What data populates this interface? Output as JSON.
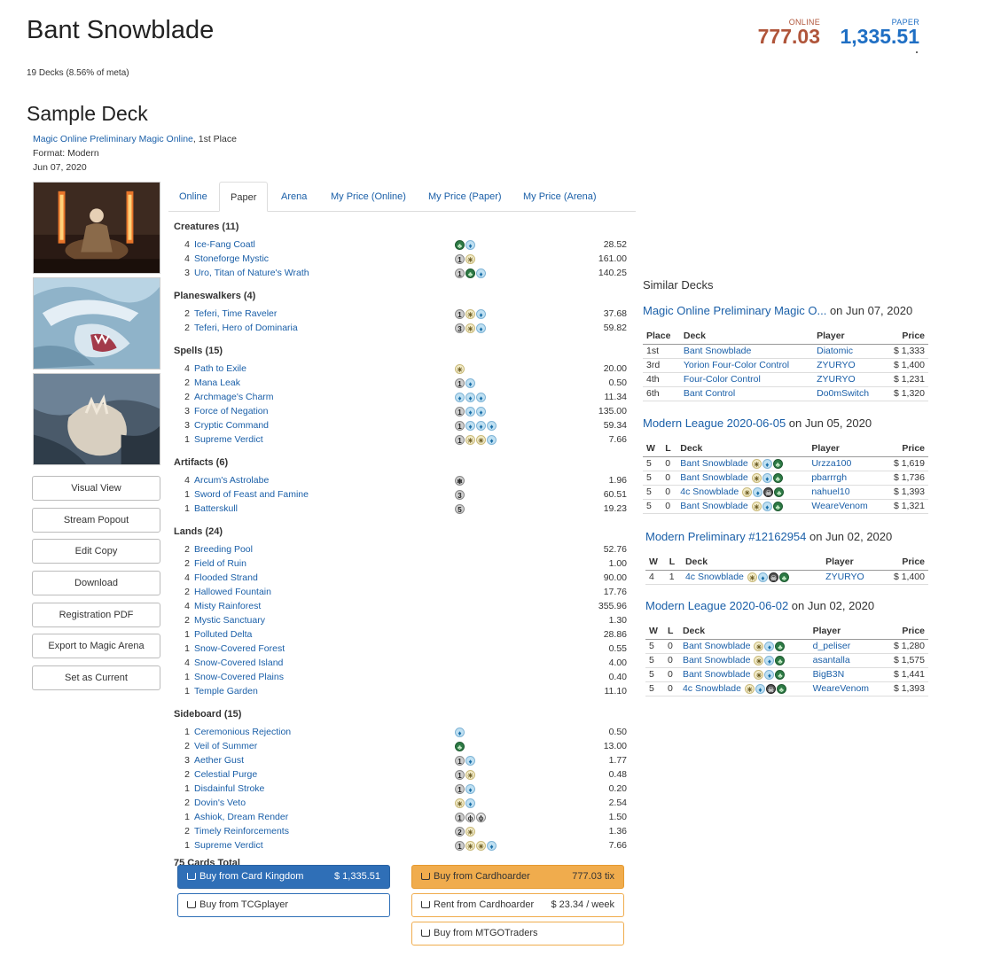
{
  "archetype": {
    "title": "Bant Snowblade",
    "meta_count": "19 Decks (8.56% of meta)"
  },
  "prices": {
    "online_label": "ONLINE",
    "online_value": "777.03",
    "paper_label": "PAPER",
    "paper_value": "1,335.51"
  },
  "sample": {
    "heading": "Sample Deck",
    "event_link": "Magic Online Preliminary Magic Online",
    "place": ", 1st Place",
    "format": "Format: Modern",
    "date": "Jun 07, 2020"
  },
  "side_buttons": [
    "Visual View",
    "Stream Popout",
    "Edit Copy",
    "Download",
    "Registration PDF",
    "Export to Magic Arena",
    "Set as Current"
  ],
  "tabs": [
    "Online",
    "Paper",
    "Arena",
    "My Price (Online)",
    "My Price (Paper)",
    "My Price (Arena)"
  ],
  "active_tab": "Paper",
  "deck": {
    "sections": [
      {
        "title": "Creatures (11)",
        "cards": [
          {
            "qty": "4",
            "name": "Ice-Fang Coatl",
            "mana": [
              "G",
              "U"
            ],
            "price": "28.52"
          },
          {
            "qty": "4",
            "name": "Stoneforge Mystic",
            "mana": [
              "1",
              "W"
            ],
            "price": "161.00"
          },
          {
            "qty": "3",
            "name": "Uro, Titan of Nature's Wrath",
            "mana": [
              "1",
              "G",
              "U"
            ],
            "price": "140.25"
          }
        ]
      },
      {
        "title": "Planeswalkers (4)",
        "cards": [
          {
            "qty": "2",
            "name": "Teferi, Time Raveler",
            "mana": [
              "1",
              "W",
              "U"
            ],
            "price": "37.68"
          },
          {
            "qty": "2",
            "name": "Teferi, Hero of Dominaria",
            "mana": [
              "3",
              "W",
              "U"
            ],
            "price": "59.82"
          }
        ]
      },
      {
        "title": "Spells (15)",
        "cards": [
          {
            "qty": "4",
            "name": "Path to Exile",
            "mana": [
              "W"
            ],
            "price": "20.00"
          },
          {
            "qty": "2",
            "name": "Mana Leak",
            "mana": [
              "1",
              "U"
            ],
            "price": "0.50"
          },
          {
            "qty": "2",
            "name": "Archmage's Charm",
            "mana": [
              "U",
              "U",
              "U"
            ],
            "price": "11.34"
          },
          {
            "qty": "3",
            "name": "Force of Negation",
            "mana": [
              "1",
              "U",
              "U"
            ],
            "price": "135.00"
          },
          {
            "qty": "3",
            "name": "Cryptic Command",
            "mana": [
              "1",
              "U",
              "U",
              "U"
            ],
            "price": "59.34"
          },
          {
            "qty": "1",
            "name": "Supreme Verdict",
            "mana": [
              "1",
              "W",
              "W",
              "U"
            ],
            "price": "7.66"
          }
        ]
      },
      {
        "title": "Artifacts (6)",
        "cards": [
          {
            "qty": "4",
            "name": "Arcum's Astrolabe",
            "mana": [
              "S"
            ],
            "price": "1.96"
          },
          {
            "qty": "1",
            "name": "Sword of Feast and Famine",
            "mana": [
              "3"
            ],
            "price": "60.51"
          },
          {
            "qty": "1",
            "name": "Batterskull",
            "mana": [
              "5"
            ],
            "price": "19.23"
          }
        ]
      },
      {
        "title": "Lands (24)",
        "cards": [
          {
            "qty": "2",
            "name": "Breeding Pool",
            "mana": [],
            "price": "52.76"
          },
          {
            "qty": "2",
            "name": "Field of Ruin",
            "mana": [],
            "price": "1.00"
          },
          {
            "qty": "4",
            "name": "Flooded Strand",
            "mana": [],
            "price": "90.00"
          },
          {
            "qty": "2",
            "name": "Hallowed Fountain",
            "mana": [],
            "price": "17.76"
          },
          {
            "qty": "4",
            "name": "Misty Rainforest",
            "mana": [],
            "price": "355.96"
          },
          {
            "qty": "2",
            "name": "Mystic Sanctuary",
            "mana": [],
            "price": "1.30"
          },
          {
            "qty": "1",
            "name": "Polluted Delta",
            "mana": [],
            "price": "28.86"
          },
          {
            "qty": "1",
            "name": "Snow-Covered Forest",
            "mana": [],
            "price": "0.55"
          },
          {
            "qty": "4",
            "name": "Snow-Covered Island",
            "mana": [],
            "price": "4.00"
          },
          {
            "qty": "1",
            "name": "Snow-Covered Plains",
            "mana": [],
            "price": "0.40"
          },
          {
            "qty": "1",
            "name": "Temple Garden",
            "mana": [],
            "price": "11.10"
          }
        ]
      },
      {
        "title": "Sideboard (15)",
        "cards": [
          {
            "qty": "1",
            "name": "Ceremonious Rejection",
            "mana": [
              "U"
            ],
            "price": "0.50"
          },
          {
            "qty": "2",
            "name": "Veil of Summer",
            "mana": [
              "G"
            ],
            "price": "13.00"
          },
          {
            "qty": "3",
            "name": "Aether Gust",
            "mana": [
              "1",
              "U"
            ],
            "price": "1.77"
          },
          {
            "qty": "2",
            "name": "Celestial Purge",
            "mana": [
              "1",
              "W"
            ],
            "price": "0.48"
          },
          {
            "qty": "1",
            "name": "Disdainful Stroke",
            "mana": [
              "1",
              "U"
            ],
            "price": "0.20"
          },
          {
            "qty": "2",
            "name": "Dovin's Veto",
            "mana": [
              "W",
              "U"
            ],
            "price": "2.54"
          },
          {
            "qty": "1",
            "name": "Ashiok, Dream Render",
            "mana": [
              "1",
              "P",
              "P"
            ],
            "price": "1.50"
          },
          {
            "qty": "2",
            "name": "Timely Reinforcements",
            "mana": [
              "2",
              "W"
            ],
            "price": "1.36"
          },
          {
            "qty": "1",
            "name": "Supreme Verdict",
            "mana": [
              "1",
              "W",
              "W",
              "U"
            ],
            "price": "7.66"
          }
        ]
      }
    ],
    "total": "75 Cards Total"
  },
  "buy": {
    "ck_label": "Buy from Card Kingdom",
    "ck_price": "$ 1,335.51",
    "tcg_label": "Buy from TCGplayer",
    "ch_label": "Buy from Cardhoarder",
    "ch_price": "777.03 tix",
    "rent_label": "Rent from Cardhoarder",
    "rent_price": "$ 23.34 / week",
    "mtgo_label": "Buy from MTGOTraders"
  },
  "similar": {
    "title": "Similar Decks",
    "events": [
      {
        "name": "Magic Online Preliminary Magic O...",
        "date": " on Jun 07, 2020",
        "headers": [
          "Place",
          "Deck",
          "Player",
          "Price"
        ],
        "rows": [
          {
            "a": "1st",
            "deck": "Bant Snowblade",
            "colors": [],
            "player": "Diatomic",
            "price": "$ 1,333"
          },
          {
            "a": "3rd",
            "deck": "Yorion Four-Color Control",
            "colors": [],
            "player": "ZYURYO",
            "price": "$ 1,400"
          },
          {
            "a": "4th",
            "deck": "Four-Color Control",
            "colors": [],
            "player": "ZYURYO",
            "price": "$ 1,231"
          },
          {
            "a": "6th",
            "deck": "Bant Control",
            "colors": [],
            "player": "Do0mSwitch",
            "price": "$ 1,320"
          }
        ]
      },
      {
        "name": "Modern League 2020-06-05",
        "date": " on Jun 05, 2020",
        "headers": [
          "W",
          "L",
          "Deck",
          "Player",
          "Price"
        ],
        "rows": [
          {
            "a": "5",
            "b": "0",
            "deck": "Bant Snowblade",
            "colors": [
              "W",
              "U",
              "G"
            ],
            "player": "Urzza100",
            "price": "$ 1,619"
          },
          {
            "a": "5",
            "b": "0",
            "deck": "Bant Snowblade",
            "colors": [
              "W",
              "U",
              "G"
            ],
            "player": "pbarrrgh",
            "price": "$ 1,736"
          },
          {
            "a": "5",
            "b": "0",
            "deck": "4c Snowblade",
            "colors": [
              "W",
              "U",
              "B",
              "G"
            ],
            "player": "nahuel10",
            "price": "$ 1,393"
          },
          {
            "a": "5",
            "b": "0",
            "deck": "Bant Snowblade",
            "colors": [
              "W",
              "U",
              "G"
            ],
            "player": "WeareVenom",
            "price": "$ 1,321"
          }
        ]
      },
      {
        "name": "Modern Preliminary #12162954",
        "date": " on Jun 02, 2020",
        "headers": [
          "W",
          "L",
          "Deck",
          "Player",
          "Price"
        ],
        "rows": [
          {
            "a": "4",
            "b": "1",
            "deck": "4c Snowblade",
            "colors": [
              "W",
              "U",
              "B",
              "G"
            ],
            "player": "ZYURYO",
            "price": "$ 1,400"
          }
        ]
      },
      {
        "name": "Modern League 2020-06-02",
        "date": " on Jun 02, 2020",
        "headers": [
          "W",
          "L",
          "Deck",
          "Player",
          "Price"
        ],
        "rows": [
          {
            "a": "5",
            "b": "0",
            "deck": "Bant Snowblade",
            "colors": [
              "W",
              "U",
              "G"
            ],
            "player": "d_peliser",
            "price": "$ 1,280"
          },
          {
            "a": "5",
            "b": "0",
            "deck": "Bant Snowblade",
            "colors": [
              "W",
              "U",
              "G"
            ],
            "player": "asantalla",
            "price": "$ 1,575"
          },
          {
            "a": "5",
            "b": "0",
            "deck": "Bant Snowblade",
            "colors": [
              "W",
              "U",
              "G"
            ],
            "player": "BigB3N",
            "price": "$ 1,441"
          },
          {
            "a": "5",
            "b": "0",
            "deck": "4c Snowblade",
            "colors": [
              "W",
              "U",
              "B",
              "G"
            ],
            "player": "WeareVenom",
            "price": "$ 1,393"
          }
        ]
      }
    ]
  },
  "colors": {
    "online": "#b0553a",
    "paper": "#1f6fc4",
    "link": "#1a5fa8",
    "ck_button": "#2f6fb7",
    "ch_button": "#f0ac4d"
  }
}
